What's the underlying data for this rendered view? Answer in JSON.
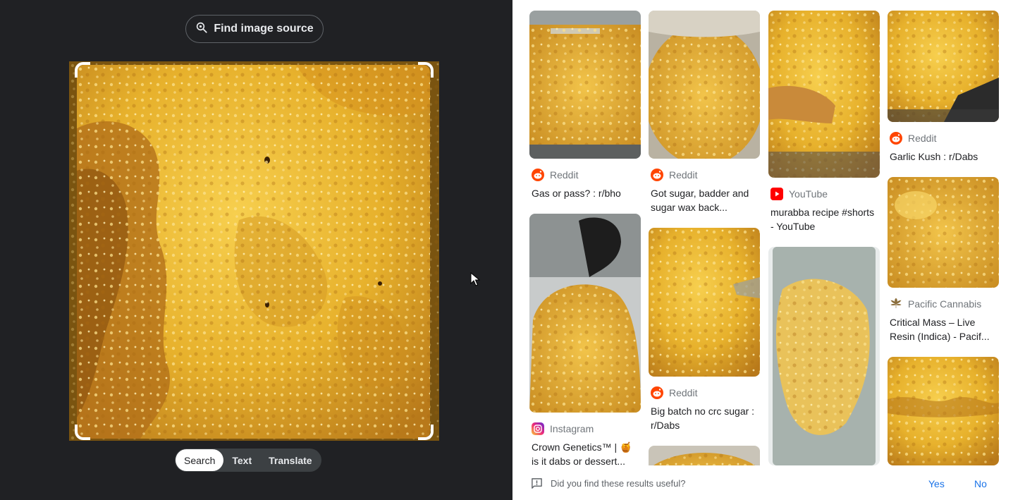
{
  "header": {
    "find_source_label": "Find image source"
  },
  "modes": [
    {
      "label": "Search",
      "active": true
    },
    {
      "label": "Text",
      "active": false
    },
    {
      "label": "Translate",
      "active": false
    }
  ],
  "results": [
    {
      "source": "Reddit",
      "source_icon": "reddit-icon",
      "title": "Gas or pass? : r/bho"
    },
    {
      "source": "Instagram",
      "source_icon": "instagram-icon",
      "title": "Crown Genetics™ | 🍯 is it dabs or dessert..."
    },
    {
      "source": "Reddit",
      "source_icon": "reddit-icon",
      "title": "Got sugar, badder and sugar wax back..."
    },
    {
      "source": "Reddit",
      "source_icon": "reddit-icon",
      "title": "Big batch no crc sugar : r/Dabs"
    },
    {
      "source": "YouTube",
      "source_icon": "youtube-icon",
      "title": "murabba recipe #shorts - YouTube"
    },
    {
      "source": "Reddit",
      "source_icon": "reddit-icon",
      "title": "Garlic Kush : r/Dabs"
    },
    {
      "source": "Pacific Cannabis",
      "source_icon": "cannabis-leaf-icon",
      "title": "Critical Mass – Live Resin (Indica) - Pacif..."
    }
  ],
  "feedback": {
    "question": "Did you find these results useful?",
    "yes_label": "Yes",
    "no_label": "No"
  },
  "colors": {
    "background_dark": "#202124",
    "link_blue": "#1a73e8",
    "reddit": "#ff4500",
    "youtube": "#ff0000"
  }
}
